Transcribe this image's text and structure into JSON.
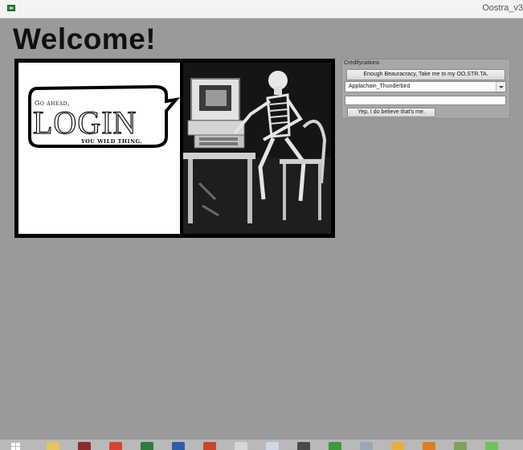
{
  "window": {
    "title": "Oostra_v3"
  },
  "heading": "Welcome!",
  "comic": {
    "go_ahead": "Go ahead,",
    "login": "LOGIN",
    "wild": "YOU WILD THING."
  },
  "credentials": {
    "legend": "Credifycations",
    "enter_button": "Enough Beauracracy, Take me to my OO.STR.TA.",
    "selected_user": "Applachain_Thunderbird",
    "password_placeholder": "",
    "confirm_button": "Yep, I do believe that's me."
  },
  "colors": {
    "background": "#9a9a9a",
    "titlebar": "#f3f3f3",
    "frame": "#000000"
  },
  "taskbar": {
    "icons": [
      {
        "name": "start-icon"
      },
      {
        "name": "file-explorer-icon",
        "color": "#e8c45a"
      },
      {
        "name": "media-app-icon",
        "color": "#8a2c2c"
      },
      {
        "name": "chrome-icon",
        "color": "#d8442f"
      },
      {
        "name": "excel-icon",
        "color": "#2f7d3c"
      },
      {
        "name": "word-icon",
        "color": "#2e5da8"
      },
      {
        "name": "powerpoint-icon",
        "color": "#c9462b"
      },
      {
        "name": "paint-icon",
        "color": "#d7d7d7"
      },
      {
        "name": "virtualbox-icon",
        "color": "#cfd8e6"
      },
      {
        "name": "p-app-icon",
        "color": "#4a4a4a"
      },
      {
        "name": "green-app-icon",
        "color": "#3e9a3a"
      },
      {
        "name": "network-icon",
        "color": "#9aa7b6"
      },
      {
        "name": "folder-icon",
        "color": "#e3b23c"
      },
      {
        "name": "orange-app-icon",
        "color": "#e07b1f"
      },
      {
        "name": "notepad-icon",
        "color": "#7fa35b"
      },
      {
        "name": "oostra-app-icon",
        "color": "#6cc35a"
      }
    ]
  }
}
